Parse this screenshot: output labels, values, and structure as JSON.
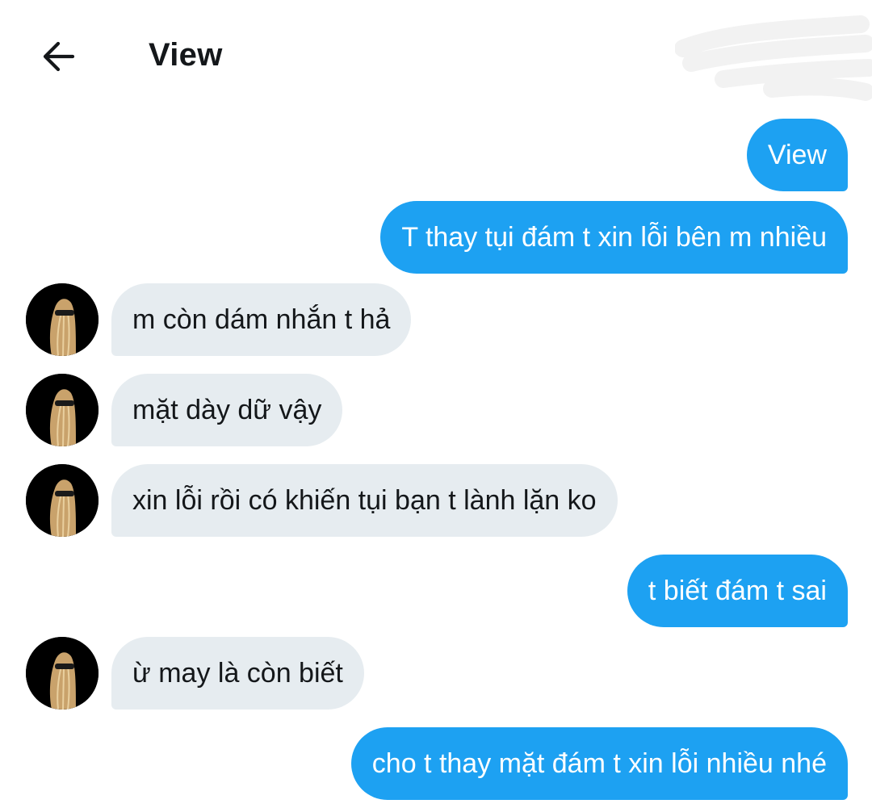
{
  "header": {
    "title": "View"
  },
  "messages": [
    {
      "text": "View"
    },
    {
      "text": "T thay tụi đám t xin lỗi bên m nhiều"
    },
    {
      "text": "m còn dám nhắn t hả"
    },
    {
      "text": "mặt dày dữ vậy"
    },
    {
      "text": "xin lỗi rồi có khiến tụi bạn t lành lặn ko"
    },
    {
      "text": "t biết đám t sai"
    },
    {
      "text": "ừ may là còn biết"
    },
    {
      "text": "cho t thay mặt đám t xin lỗi nhiều nhé"
    }
  ],
  "colors": {
    "sent_bubble": "#1da1f2",
    "received_bubble": "#e6ecf0",
    "text_dark": "#14171a"
  },
  "icons": {
    "back": "arrow-left-icon",
    "avatar": "user-avatar"
  }
}
